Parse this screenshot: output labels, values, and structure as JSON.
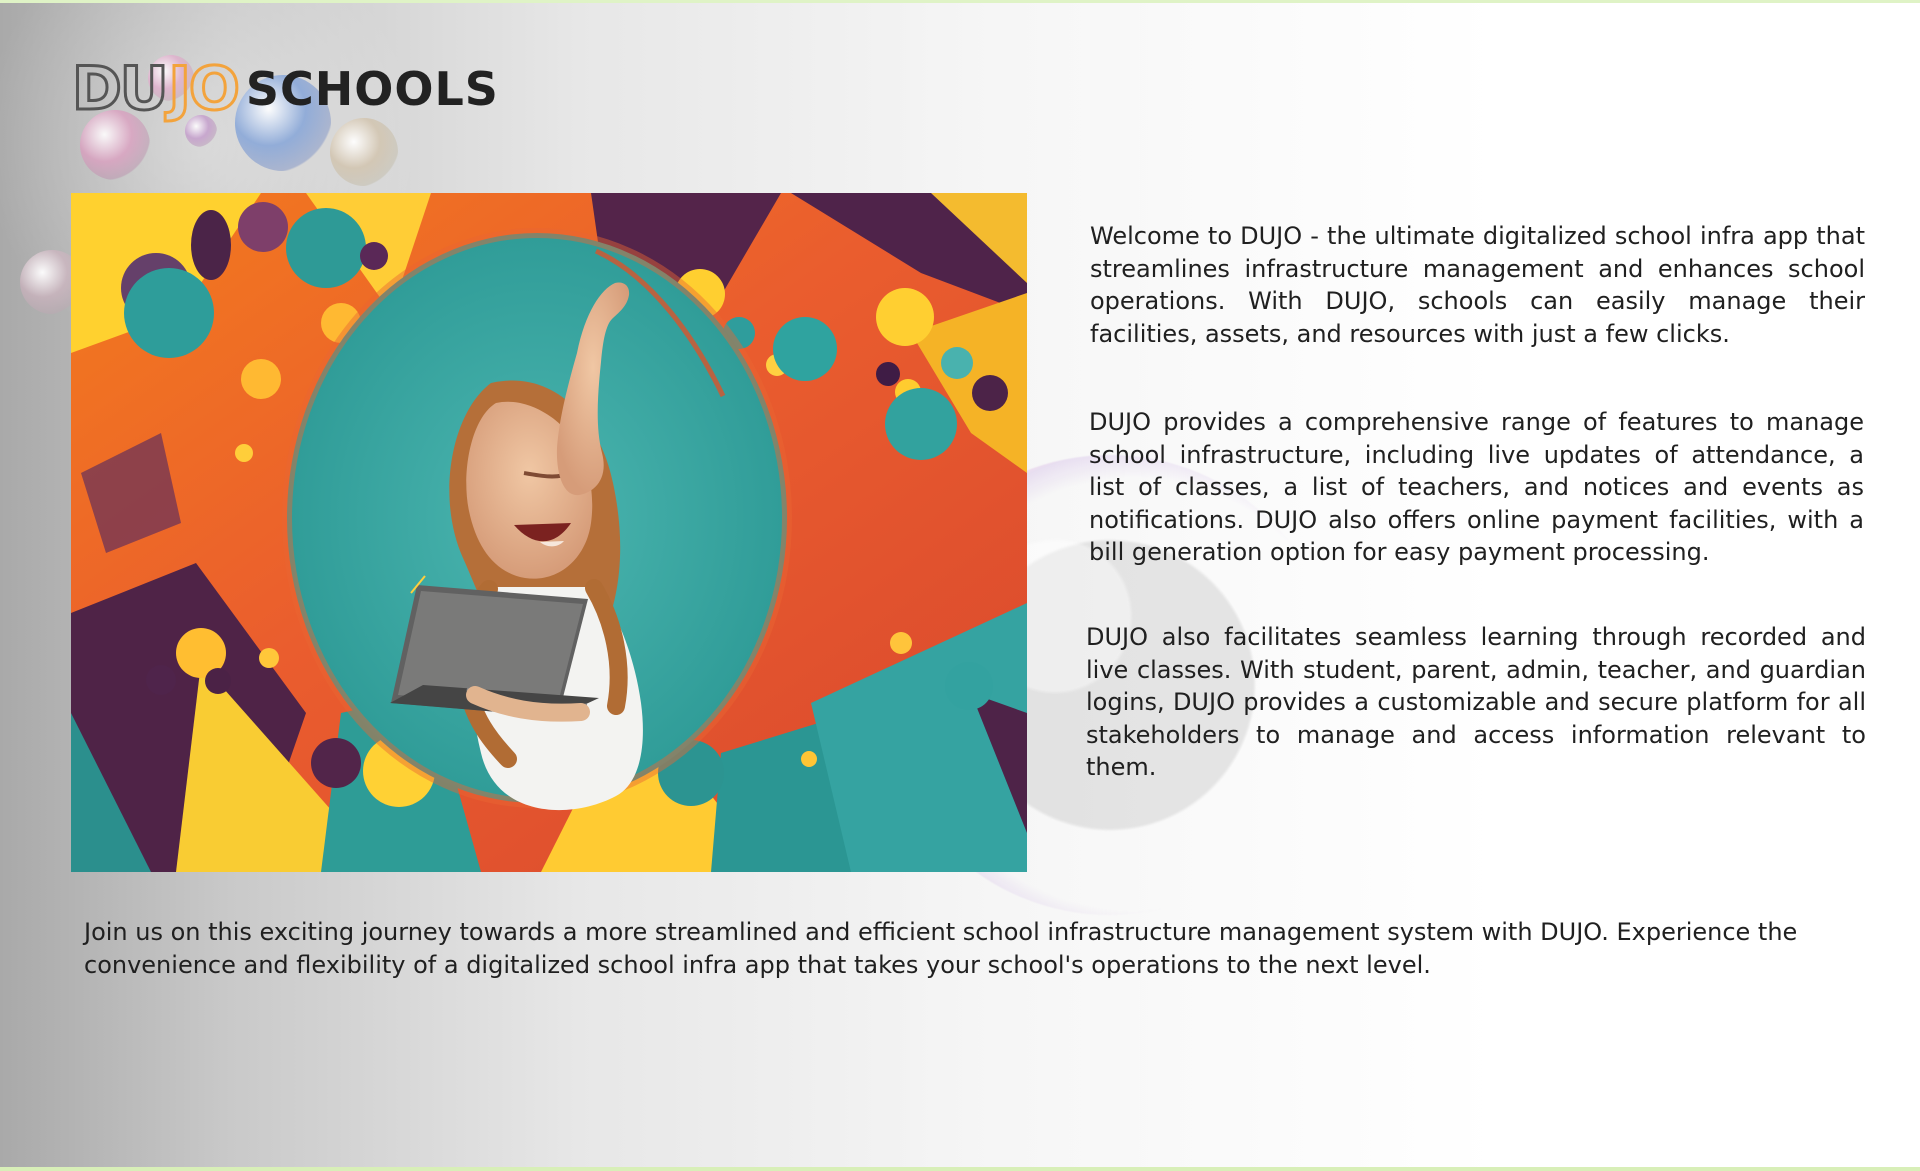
{
  "branding": {
    "logo_mark_left": "DU",
    "logo_mark_right": "JO",
    "logo_text": "SCHOOLS"
  },
  "hero": {
    "image_alt": "Excited woman holding a laptop against a colorful geometric background"
  },
  "content": {
    "paragraph_1": "Welcome to DUJO - the ultimate digitalized school infra app that streamlines infrastructure management and enhances school operations. With DUJO, schools can easily manage their facilities, assets, and resources with just a few clicks.",
    "paragraph_2": "DUJO provides a comprehensive range of features to manage school infrastructure, including live updates of attendance, a list of classes, a list of teachers, and notices and events as notifications. DUJO also offers online payment facilities, with a bill generation option for easy payment processing.",
    "paragraph_3": "DUJO also facilitates seamless learning through recorded and live classes. With student, parent, admin, teacher, and guardian logins, DUJO provides a customizable and secure platform for all stakeholders to manage and access information relevant to them.",
    "paragraph_4": "Join us on this exciting journey towards a more streamlined and efficient school infrastructure management system with DUJO. Experience the convenience and flexibility of a digitalized school infra app that takes your school's operations to the next level."
  },
  "colors": {
    "brand_orange": "#f3a33c",
    "brand_gray": "#555555",
    "text_dark": "#202020"
  }
}
